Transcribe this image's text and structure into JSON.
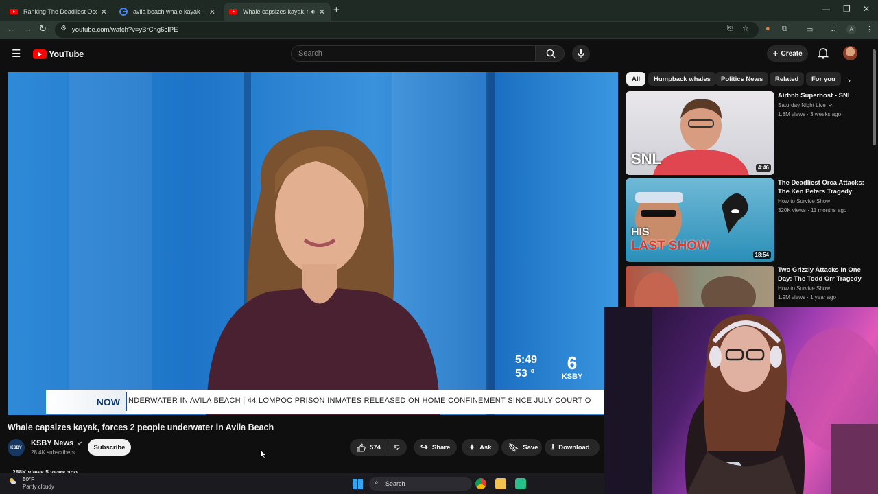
{
  "browser": {
    "tabs": [
      {
        "title": "Ranking The Deadliest Ocean P",
        "icon": "youtube-icon"
      },
      {
        "title": "avila beach whale kayak - Goog",
        "icon": "google-icon"
      },
      {
        "title": "Whale capsizes kayak, force",
        "icon": "youtube-icon",
        "active": true,
        "audio": "speaker-icon"
      }
    ],
    "new_tab": "+",
    "url": "youtube.com/watch?v=yBrChg6cIPE",
    "profile_initial": "A"
  },
  "youtube": {
    "brand": "YouTube",
    "search_placeholder": "Search",
    "create_label": "Create",
    "accent": "#ff0000"
  },
  "video": {
    "clock_time": "5:49",
    "temperature": "53 °",
    "station_logo": "KSBY",
    "ticker_label": "NOW",
    "ticker_text": "NDERWATER IN AVILA BEACH     |     44 LOMPOC PRISON INMATES RELEASED ON HOME CONFINEMENT SINCE JULY COURT O",
    "title": "Whale capsizes kayak, forces 2 people underwater in Avila Beach",
    "channel": {
      "name": "KSBY News",
      "subscribers": "28.4K subscribers",
      "avatar_text": "KSBY"
    },
    "subscribe_label": "Subscribe",
    "likes": "574",
    "share_label": "Share",
    "ask_label": "Ask",
    "save_label": "Save",
    "download_label": "Download",
    "meta": "288K views  5 years ago"
  },
  "chips": [
    "All",
    "Humpback whales",
    "Politics News",
    "Related",
    "For you"
  ],
  "recommendations": [
    {
      "title": "Airbnb Superhost - SNL",
      "channel": "Saturday Night Live",
      "verified": true,
      "meta": "1.8M views · 3 weeks ago",
      "duration": "4:46",
      "thumb_text": "SNL"
    },
    {
      "title": "The Deadliest Orca Attacks: The Ken Peters Tragedy",
      "channel": "How to Survive Show",
      "meta": "320K views · 11 months ago",
      "duration": "18:54",
      "thumb_text_1": "HIS",
      "thumb_text_2": "LAST SHOW"
    },
    {
      "title": "Two Grizzly Attacks in One Day: The Todd Orr Tragedy",
      "channel": "How to Survive Show",
      "meta": "1.9M views · 1 year ago"
    }
  ],
  "taskbar": {
    "weather_temp": "50°F",
    "weather_desc": "Partly cloudy",
    "search_label": "Search"
  }
}
